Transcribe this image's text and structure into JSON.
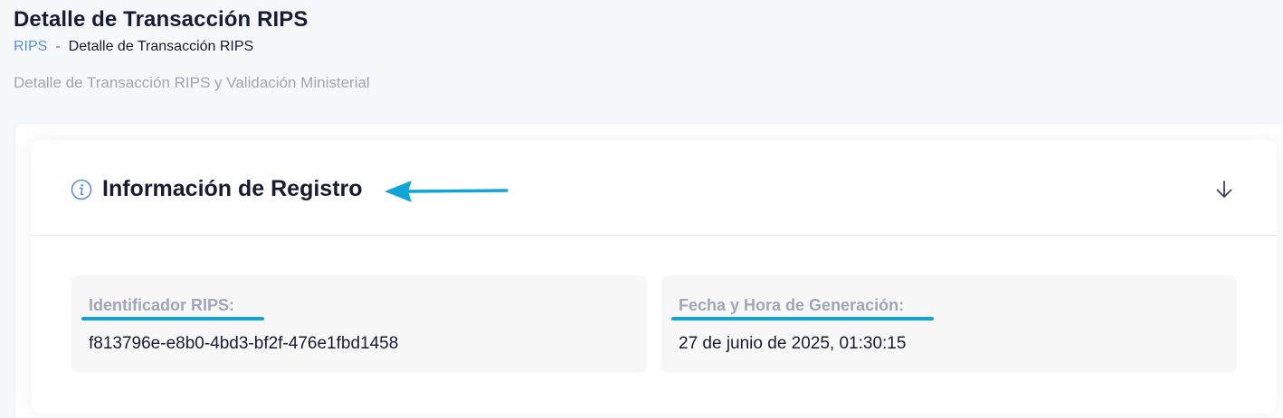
{
  "header": {
    "title": "Detalle de Transacción RIPS",
    "breadcrumb": {
      "root": "RIPS",
      "separator": "-",
      "current": "Detalle de Transacción RIPS"
    },
    "subtitle": "Detalle de Transacción RIPS y Validación Ministerial"
  },
  "section": {
    "title": "Información de Registro",
    "icon": "info-icon",
    "toggle_icon": "arrow-down-icon",
    "annotation_color": "#0ea5d8"
  },
  "fields": [
    {
      "label": "Identificador RIPS:",
      "value": "f813796e-e8b0-4bd3-bf2f-476e1fbd1458"
    },
    {
      "label": "Fecha y Hora de Generación:",
      "value": "27 de junio de 2025, 01:30:15"
    }
  ],
  "colors": {
    "accent": "#0ea5d8",
    "link": "#5e8dd6",
    "heading": "#181c32",
    "muted": "#a1a5b7"
  }
}
